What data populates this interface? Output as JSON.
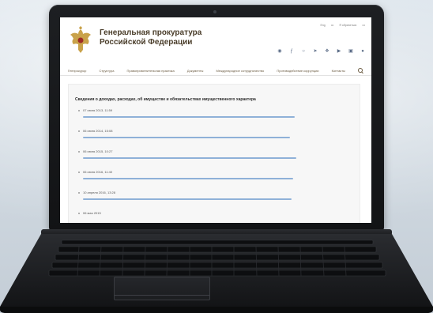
{
  "site": {
    "title_line1": "Генеральная прокуратура",
    "title_line2": "Российской Федерации",
    "top_links": [
      "Eng",
      "•••",
      "Я обратиться",
      "•••"
    ]
  },
  "social_icons": [
    "vk-icon",
    "facebook-icon",
    "ok-icon",
    "telegram-icon",
    "twitter-icon",
    "youtube-icon",
    "instagram-icon",
    "rutube-icon"
  ],
  "nav": {
    "items": [
      "Генпрокурор",
      "Структура",
      "Правоприменительная практика",
      "Документы",
      "Международное сотрудничество",
      "Противодействие коррупции",
      "Контакты"
    ]
  },
  "page": {
    "heading": "Сведения о доходах, расходах, об имуществе и обязательствах имущественного характера",
    "items": [
      {
        "date": "07 июня 2013, 11:59"
      },
      {
        "date": "06 июня 2014, 15:08"
      },
      {
        "date": "06 июня 2015, 10:27"
      },
      {
        "date": "06 июня 2016, 11:40"
      },
      {
        "date": "10 апреля 2016, 13:28"
      },
      {
        "date": "06 мая 2015"
      }
    ]
  },
  "colors": {
    "title": "#4a3d2a",
    "link": "#8fb1d8",
    "nav": "#6a5a40"
  }
}
